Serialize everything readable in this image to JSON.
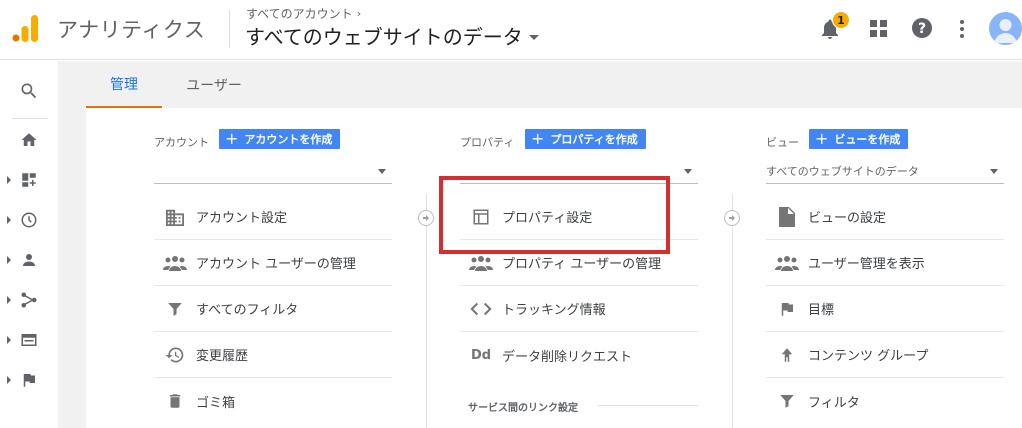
{
  "header": {
    "app_title": "アナリティクス",
    "breadcrumb": "すべてのアカウント",
    "breadcrumb_chevron": "›",
    "site_title": "すべてのウェブサイトのデータ",
    "notification_count": "1"
  },
  "rail": {
    "items": [
      {
        "icon": "search-icon"
      },
      {
        "icon": "home-icon"
      },
      {
        "icon": "customization-icon"
      },
      {
        "icon": "realtime-clock-icon"
      },
      {
        "icon": "audience-person-icon"
      },
      {
        "icon": "acquisition-icon"
      },
      {
        "icon": "behavior-icon"
      },
      {
        "icon": "conversions-flag-icon"
      }
    ]
  },
  "tabs": {
    "admin": "管理",
    "user": "ユーザー"
  },
  "account": {
    "label": "アカウント",
    "create_button": "アカウントを作成",
    "selected": "",
    "items": [
      {
        "label": "アカウント設定",
        "icon": "building-icon"
      },
      {
        "label": "アカウント ユーザーの管理",
        "icon": "people-icon"
      },
      {
        "label": "すべてのフィルタ",
        "icon": "filter-icon"
      },
      {
        "label": "変更履歴",
        "icon": "history-icon"
      },
      {
        "label": "ゴミ箱",
        "icon": "trash-icon"
      }
    ]
  },
  "property": {
    "label": "プロパティ",
    "create_button": "プロパティを作成",
    "selected": "",
    "items": [
      {
        "label": "プロパティ設定",
        "icon": "layout-icon"
      },
      {
        "label": "プロパティ ユーザーの管理",
        "icon": "people-icon"
      },
      {
        "label": "トラッキング情報",
        "icon": "code-icon"
      },
      {
        "label": "データ削除リクエスト",
        "icon": "dd-icon",
        "icon_text": "Dd"
      }
    ],
    "section_heading": "サービス間のリンク設定"
  },
  "view": {
    "label": "ビュー",
    "create_button": "ビューを作成",
    "selected": "すべてのウェブサイトのデータ",
    "items": [
      {
        "label": "ビューの設定",
        "icon": "document-icon"
      },
      {
        "label": "ユーザー管理を表示",
        "icon": "people-icon"
      },
      {
        "label": "目標",
        "icon": "flag-icon"
      },
      {
        "label": "コンテンツ グループ",
        "icon": "walker-icon"
      },
      {
        "label": "フィルタ",
        "icon": "filter-icon"
      }
    ]
  },
  "colors": {
    "accent": "#1a73e8",
    "button": "#4285f4",
    "tab_underline": "#e8710a",
    "highlight_box": "#d32f2f",
    "badge": "#f9ab00"
  }
}
